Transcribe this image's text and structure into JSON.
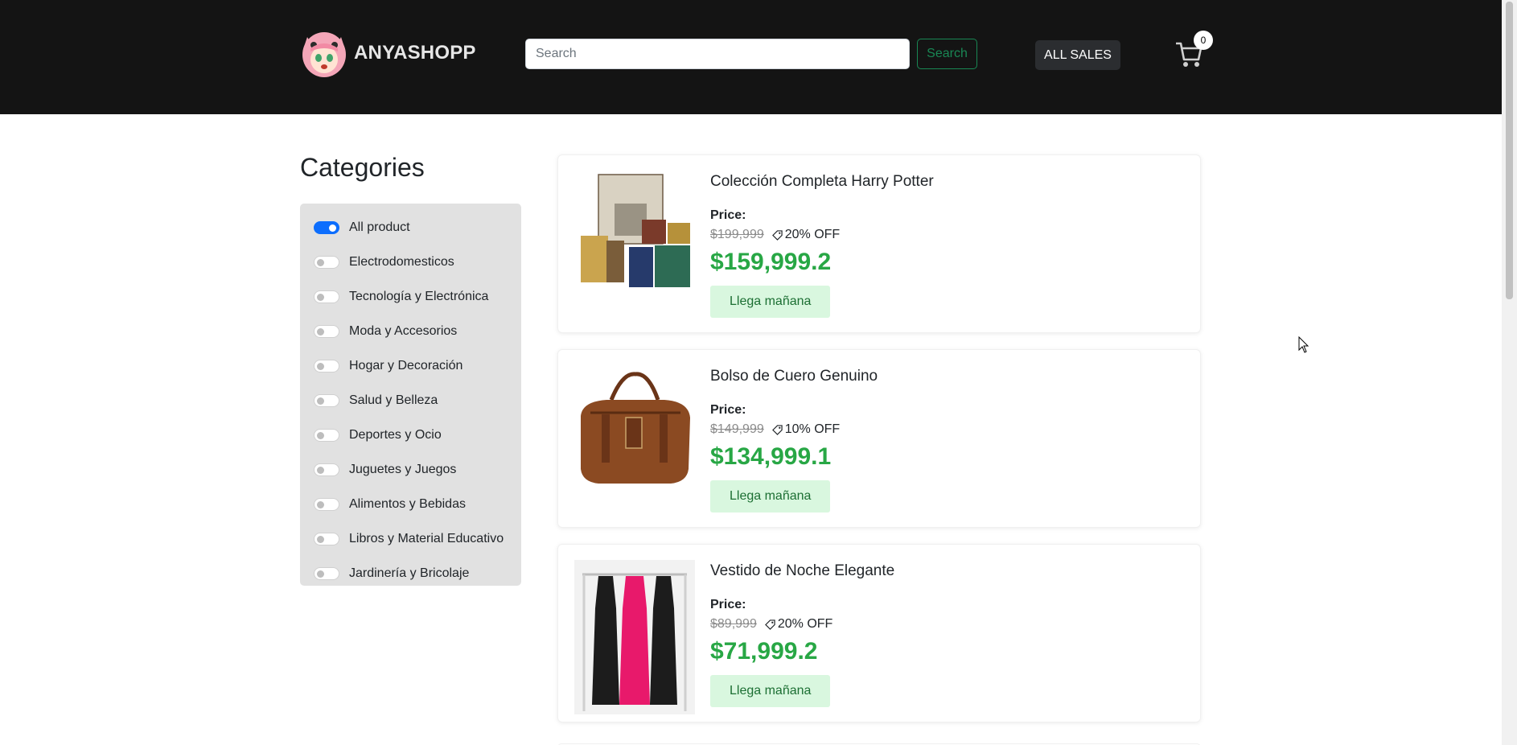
{
  "header": {
    "brand": "ANYASHOPP",
    "search_placeholder": "Search",
    "search_button": "Search",
    "all_sales": "ALL SALES",
    "cart_count": "0"
  },
  "categories": {
    "title": "Categories",
    "items": [
      {
        "label": "All product",
        "active": true
      },
      {
        "label": "Electrodomesticos",
        "active": false
      },
      {
        "label": "Tecnología y Electrónica",
        "active": false
      },
      {
        "label": "Moda y Accesorios",
        "active": false
      },
      {
        "label": "Hogar y Decoración",
        "active": false
      },
      {
        "label": "Salud y Belleza",
        "active": false
      },
      {
        "label": "Deportes y Ocio",
        "active": false
      },
      {
        "label": "Juguetes y Juegos",
        "active": false
      },
      {
        "label": "Alimentos y Bebidas",
        "active": false
      },
      {
        "label": "Libros y Material Educativo",
        "active": false
      },
      {
        "label": "Jardinería y Bricolaje",
        "active": false
      }
    ]
  },
  "products": [
    {
      "title": "Colección Completa Harry Potter",
      "price_label": "Price:",
      "old_price": "$199,999",
      "discount": "20% OFF",
      "new_price": "$159,999.2",
      "shipping": "Llega mañana",
      "image": "harry-potter-collection-image"
    },
    {
      "title": "Bolso de Cuero Genuino",
      "price_label": "Price:",
      "old_price": "$149,999",
      "discount": "10% OFF",
      "new_price": "$134,999.1",
      "shipping": "Llega mañana",
      "image": "leather-bag-image"
    },
    {
      "title": "Vestido de Noche Elegante",
      "price_label": "Price:",
      "old_price": "$89,999",
      "discount": "20% OFF",
      "new_price": "$71,999.2",
      "shipping": "Llega mañana",
      "image": "evening-dress-image"
    }
  ],
  "colors": {
    "header_bg": "#141414",
    "accent_green": "#28a745",
    "toggle_on": "#0d6efd",
    "ship_bg": "#d9f7df"
  }
}
